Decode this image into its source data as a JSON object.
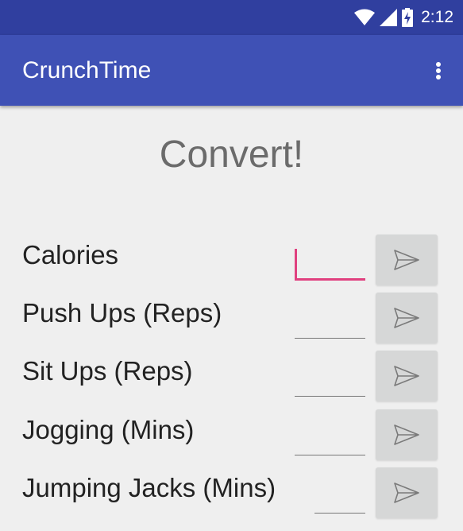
{
  "status_bar": {
    "time": "2:12",
    "icons": [
      "wifi-icon",
      "signal-icon",
      "battery-charging-icon"
    ]
  },
  "app_bar": {
    "title": "CrunchTime",
    "menu_icon": "more-vert-icon",
    "color": "#3f51b5"
  },
  "main": {
    "heading": "Convert!",
    "rows": [
      {
        "label": "Calories",
        "value": "",
        "focused": true
      },
      {
        "label": "Push Ups (Reps)",
        "value": "",
        "focused": false
      },
      {
        "label": "Sit Ups (Reps)",
        "value": "",
        "focused": false
      },
      {
        "label": "Jogging (Mins)",
        "value": "",
        "focused": false
      },
      {
        "label": "Jumping Jacks (Mins)",
        "value": "",
        "focused": false
      }
    ],
    "send_icon": "send-icon",
    "accent_color": "#e0407f"
  }
}
